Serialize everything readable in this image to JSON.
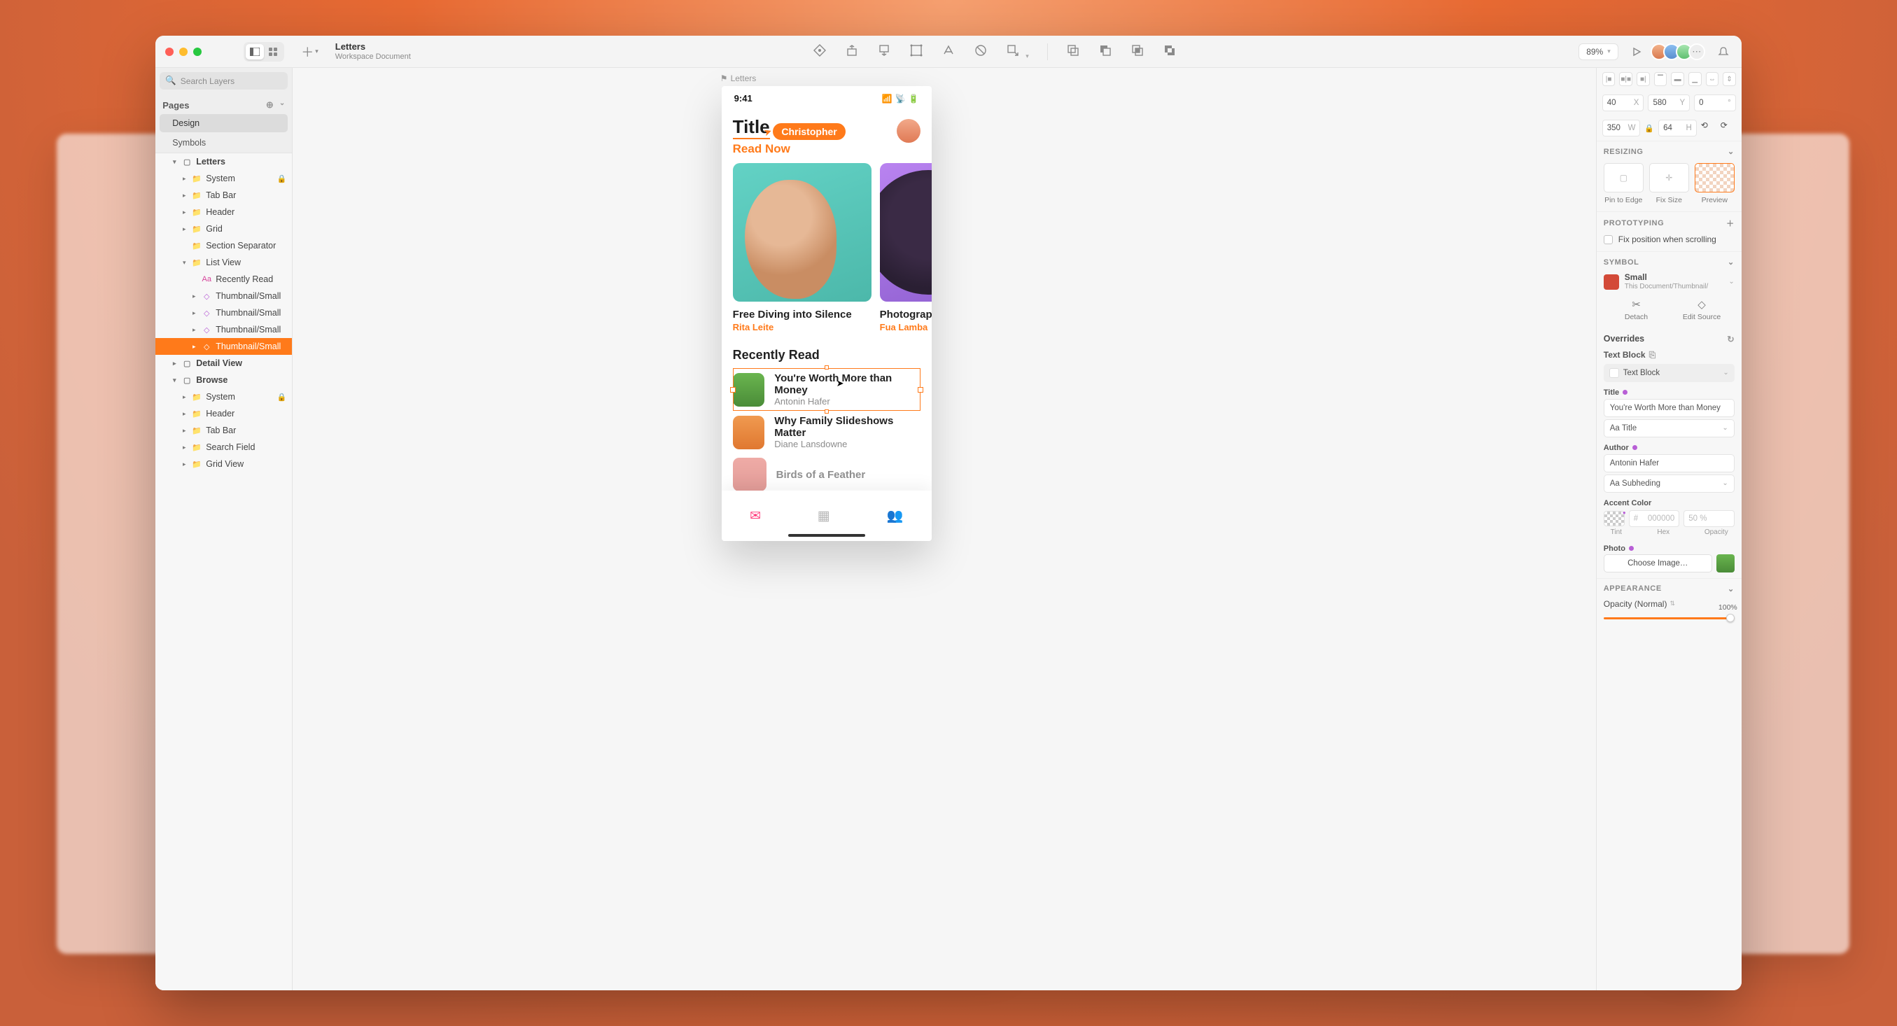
{
  "doc": {
    "title": "Letters",
    "subtitle": "Workspace Document"
  },
  "toolbar": {
    "zoom": "89%"
  },
  "sidebar": {
    "search_placeholder": "Search Layers",
    "pages_label": "Pages",
    "pages": {
      "design": "Design",
      "symbols": "Symbols"
    },
    "artboards": {
      "letters": "Letters",
      "system1": "System",
      "tabbar1": "Tab Bar",
      "header1": "Header",
      "grid": "Grid",
      "section_sep": "Section Separator",
      "listview": "List View",
      "recently_read": "Recently Read",
      "thumb1": "Thumbnail/Small",
      "thumb2": "Thumbnail/Small",
      "thumb3": "Thumbnail/Small",
      "thumb4": "Thumbnail/Small",
      "detail": "Detail View",
      "browse": "Browse",
      "system2": "System",
      "header2": "Header",
      "tabbar2": "Tab Bar",
      "searchfield": "Search Field",
      "gridview": "Grid View"
    }
  },
  "canvas": {
    "artboard_label": "Letters",
    "status_time": "9:41",
    "collaborator": "Christopher",
    "hero_title": "Title",
    "hero_sub": "Read Now",
    "card1_title": "Free Diving into Silence",
    "card1_author": "Rita Leite",
    "card2_title": "Photographi",
    "card2_author": "Fua Lamba",
    "section": "Recently Read",
    "item1_title": "You're Worth More than Money",
    "item1_author": "Antonin Hafer",
    "item2_title": "Why Family Slideshows Matter",
    "item2_author": "Diane Lansdowne",
    "item3_title": "Birds of a Feather"
  },
  "inspector": {
    "x": "40",
    "y": "580",
    "rot": "0",
    "w": "350",
    "h": "64",
    "resizing": "RESIZING",
    "pin": "Pin to Edge",
    "fix": "Fix Size",
    "preview": "Preview",
    "prototyping": "PROTOTYPING",
    "fixpos": "Fix position when scrolling",
    "symbol": "SYMBOL",
    "sym_name": "Small",
    "sym_path": "This Document/Thumbnail/",
    "detach": "Detach",
    "edit": "Edit Source",
    "overrides": "Overrides",
    "text_block": "Text Block",
    "title_lbl": "Title",
    "title_val": "You're Worth More than Money",
    "aa_title": "Aa Title",
    "author_lbl": "Author",
    "author_val": "Antonin Hafer",
    "aa_sub": "Aa Subheding",
    "accent": "Accent Color",
    "hex_ph": "000000",
    "opacity_val": "50 %",
    "tint": "Tint",
    "hex": "Hex",
    "opacity": "Opacity",
    "photo": "Photo",
    "choose_img": "Choose Image…",
    "appearance": "APPEARANCE",
    "opnormal": "Opacity (Normal)",
    "slider_val": "100%"
  }
}
